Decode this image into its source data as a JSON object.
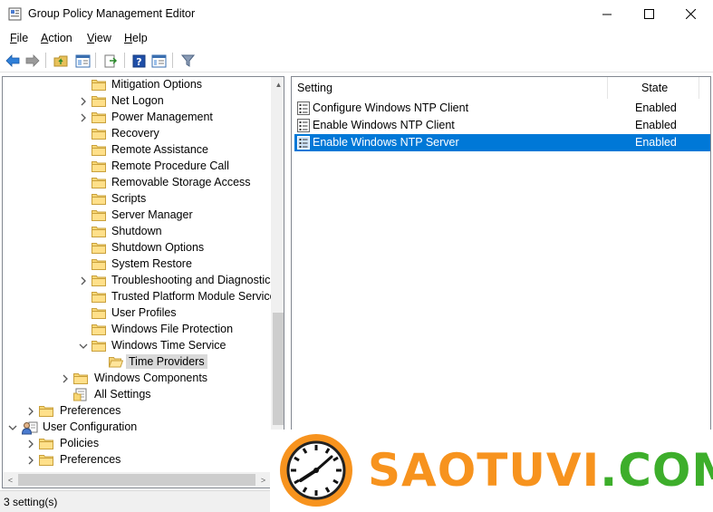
{
  "window": {
    "title": "Group Policy Management Editor",
    "minimize_glyph": "—",
    "maximize_glyph": "☐",
    "close_glyph": "✕"
  },
  "menu": [
    {
      "label": "File",
      "accel": "F",
      "rest": "ile"
    },
    {
      "label": "Action",
      "accel": "A",
      "rest": "ction"
    },
    {
      "label": "View",
      "accel": "V",
      "rest": "iew"
    },
    {
      "label": "Help",
      "accel": "H",
      "rest": "elp"
    }
  ],
  "toolbar": {
    "icons": [
      "back-arrow-icon",
      "forward-arrow-icon",
      "up-folder-icon",
      "show-hide-tree-icon",
      "export-list-icon",
      "help-icon",
      "properties-icon",
      "filter-icon"
    ]
  },
  "tree": {
    "items": [
      {
        "label": "Mitigation Options",
        "expander": "",
        "icon": "folder"
      },
      {
        "label": "Net Logon",
        "expander": "collapsed",
        "icon": "folder"
      },
      {
        "label": "Power Management",
        "expander": "collapsed",
        "icon": "folder"
      },
      {
        "label": "Recovery",
        "expander": "",
        "icon": "folder"
      },
      {
        "label": "Remote Assistance",
        "expander": "",
        "icon": "folder"
      },
      {
        "label": "Remote Procedure Call",
        "expander": "",
        "icon": "folder"
      },
      {
        "label": "Removable Storage Access",
        "expander": "",
        "icon": "folder"
      },
      {
        "label": "Scripts",
        "expander": "",
        "icon": "folder"
      },
      {
        "label": "Server Manager",
        "expander": "",
        "icon": "folder"
      },
      {
        "label": "Shutdown",
        "expander": "",
        "icon": "folder"
      },
      {
        "label": "Shutdown Options",
        "expander": "",
        "icon": "folder"
      },
      {
        "label": "System Restore",
        "expander": "",
        "icon": "folder"
      },
      {
        "label": "Troubleshooting and Diagnostics",
        "expander": "collapsed",
        "icon": "folder"
      },
      {
        "label": "Trusted Platform Module Services",
        "expander": "",
        "icon": "folder"
      },
      {
        "label": "User Profiles",
        "expander": "",
        "icon": "folder"
      },
      {
        "label": "Windows File Protection",
        "expander": "",
        "icon": "folder"
      },
      {
        "label": "Windows Time Service",
        "expander": "expanded",
        "icon": "folder"
      },
      {
        "label": "Time Providers",
        "expander": "",
        "icon": "folder-open",
        "selected": true
      },
      {
        "label": "Windows Components",
        "expander": "collapsed",
        "icon": "folder"
      },
      {
        "label": "All Settings",
        "expander": "",
        "icon": "all-settings"
      },
      {
        "label": "Preferences",
        "expander": "collapsed",
        "icon": "folder"
      },
      {
        "label": "User Configuration",
        "expander": "expanded",
        "icon": "user-config"
      },
      {
        "label": "Policies",
        "expander": "collapsed",
        "icon": "folder"
      },
      {
        "label": "Preferences",
        "expander": "collapsed",
        "icon": "folder"
      }
    ]
  },
  "list": {
    "columns": {
      "setting": "Setting",
      "state": "State"
    },
    "rows": [
      {
        "name": "Configure Windows NTP Client",
        "state": "Enabled",
        "selected": false
      },
      {
        "name": "Enable Windows NTP Client",
        "state": "Enabled",
        "selected": false
      },
      {
        "name": "Enable Windows NTP Server",
        "state": "Enabled",
        "selected": true
      }
    ]
  },
  "status": {
    "text": "3 setting(s)"
  },
  "watermark": {
    "text_part1": "SAOTUVI",
    "text_part2": ".COM",
    "color1": "#f7931e",
    "color2": "#3dae2b"
  },
  "colors": {
    "selection": "#0078d7",
    "tree_selection": "#d9d9d9"
  }
}
